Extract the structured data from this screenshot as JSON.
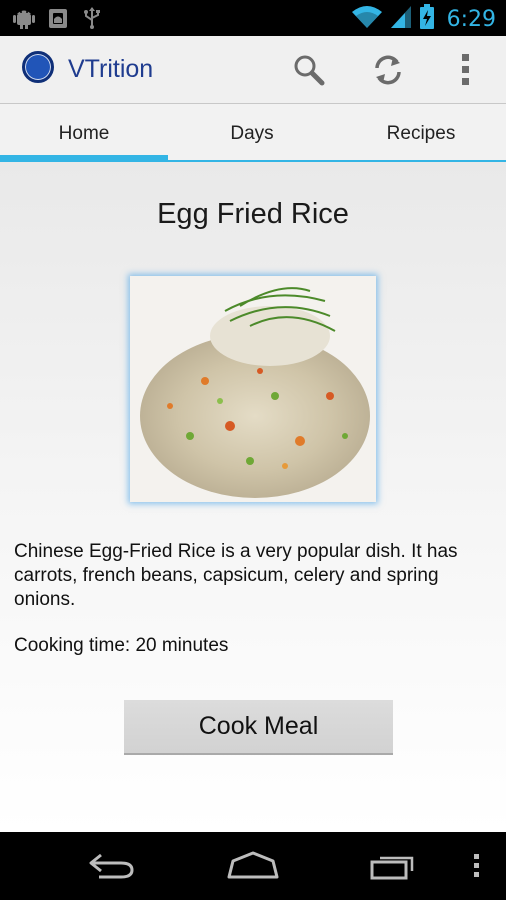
{
  "status_bar": {
    "time": "6:29",
    "icons": [
      "android-debug-icon",
      "android-sd-icon",
      "usb-icon",
      "wifi-icon",
      "signal-icon",
      "battery-charging-icon"
    ]
  },
  "action_bar": {
    "app_title": "VTrition",
    "actions": [
      "search-icon",
      "refresh-icon",
      "overflow-menu-icon"
    ]
  },
  "tabs": [
    {
      "label": "Home",
      "selected": true
    },
    {
      "label": "Days",
      "selected": false
    },
    {
      "label": "Recipes",
      "selected": false
    }
  ],
  "recipe": {
    "title": "Egg Fried Rice",
    "image_icon": "fried-rice-photo",
    "description": "Chinese Egg-Fried Rice is a very popular dish. It has carrots, french beans, capsicum, celery and spring onions.",
    "cooking_time": "Cooking time: 20 minutes",
    "button_label": "Cook Meal"
  },
  "nav_bar": {
    "buttons": [
      "back-icon",
      "home-icon",
      "recent-apps-icon",
      "menu-icon"
    ]
  },
  "colors": {
    "accent": "#33b5e5",
    "title_blue": "#1f3c8f"
  }
}
